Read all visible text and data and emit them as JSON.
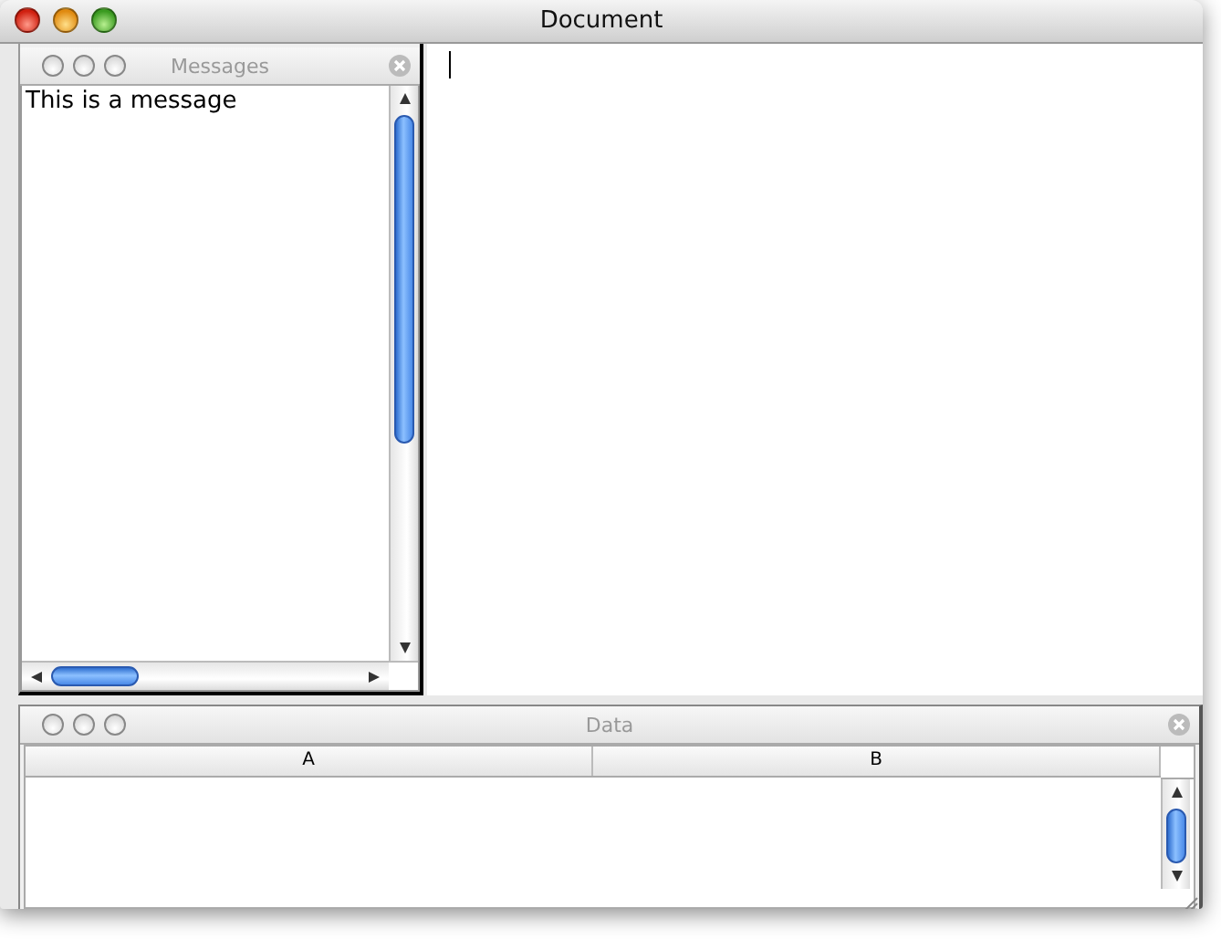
{
  "window": {
    "title": "Document"
  },
  "messages_panel": {
    "title": "Messages",
    "lines": [
      "This is a message"
    ]
  },
  "data_panel": {
    "title": "Data",
    "columns": [
      "A",
      "B"
    ]
  }
}
